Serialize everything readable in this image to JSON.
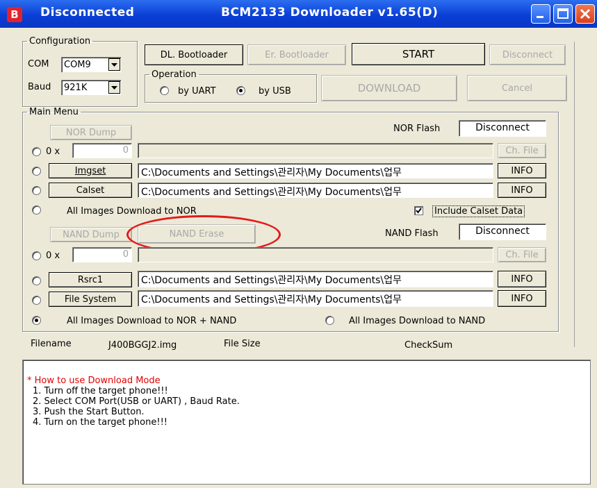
{
  "titlebar": {
    "icon_letter": "B",
    "status": "Disconnected",
    "app_title": "BCM2133 Downloader v1.65(D)"
  },
  "config": {
    "legend": "Configuration",
    "com_label": "COM",
    "com_value": "COM9",
    "baud_label": "Baud",
    "baud_value": "921K"
  },
  "top_buttons": {
    "dl_bootloader": "DL. Bootloader",
    "er_bootloader": "Er. Bootloader",
    "start": "START",
    "disconnect": "Disconnect",
    "download": "DOWNLOAD",
    "cancel": "Cancel"
  },
  "operation": {
    "legend": "Operation",
    "by_uart": "by UART",
    "by_usb": "by USB",
    "selected": "by USB"
  },
  "main_menu": {
    "legend": "Main Menu",
    "nor_dump": "NOR Dump",
    "nor_flash_label": "NOR Flash",
    "nor_flash_status": "Disconnect",
    "hex_prefix": "0 x",
    "nor_addr_value": "0",
    "ch_file": "Ch. File",
    "imgset": "Imgset",
    "imgset_path": "C:\\Documents and Settings\\관리자\\My Documents\\업무",
    "calset": "Calset",
    "calset_path": "C:\\Documents and Settings\\관리자\\My Documents\\업무",
    "info": "INFO",
    "all_nor": "All Images Download to NOR",
    "include_calset": "Include Calset Data",
    "include_calset_checked": true,
    "nand_dump": "NAND Dump",
    "nand_erase": "NAND Erase",
    "nand_flash_label": "NAND Flash",
    "nand_flash_status": "Disconnect",
    "nand_addr_value": "0",
    "rsrc1": "Rsrc1",
    "rsrc1_path": "C:\\Documents and Settings\\관리자\\My Documents\\업무",
    "file_system": "File System",
    "file_system_path": "C:\\Documents and Settings\\관리자\\My Documents\\업무",
    "all_nor_nand": "All Images Download to NOR + NAND",
    "all_nand": "All Images Download to NAND"
  },
  "file_info": {
    "filename_label": "Filename",
    "filename_value": "J400BGGJ2.img",
    "filesize_label": "File Size",
    "checksum_label": "CheckSum"
  },
  "log": {
    "heading": "* How to use Download Mode",
    "lines": [
      "1. Turn off the target phone!!!",
      "2. Select COM Port(USB or UART) , Baud Rate.",
      "3. Push the Start Button.",
      "4. Turn on the target phone!!!"
    ]
  },
  "colors": {
    "titlebar": "#0a3fd6",
    "annotation_circle": "#e31a1a",
    "log_heading": "#e00000",
    "window_bg": "#ece9d8"
  }
}
